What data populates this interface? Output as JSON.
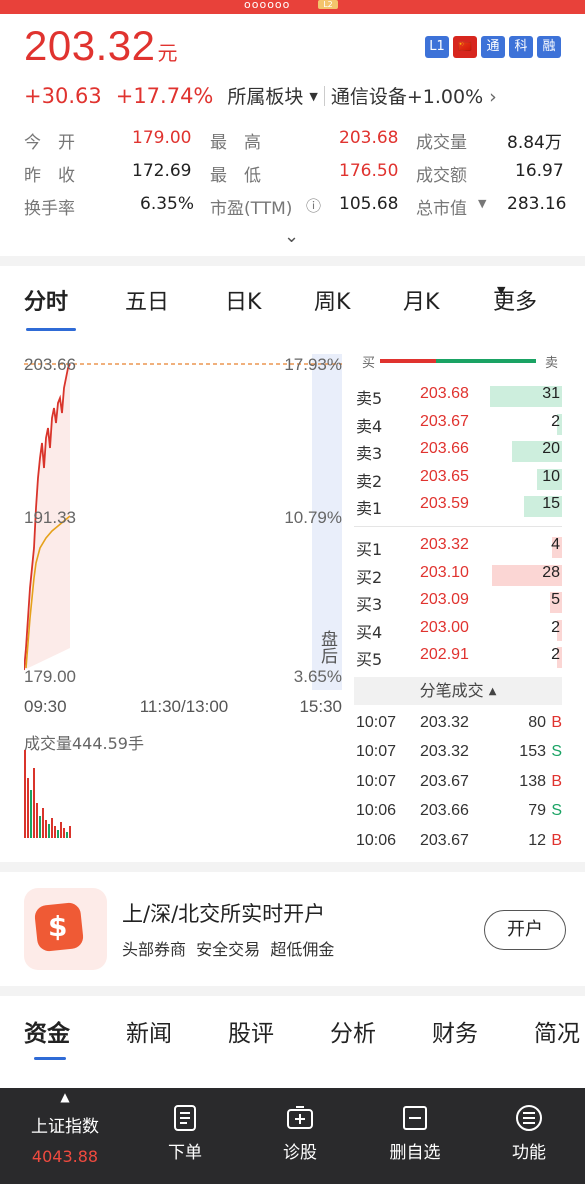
{
  "status": {
    "dots": "oooooo",
    "badge": "L2"
  },
  "header": {
    "price": "203.32",
    "price_unit": "元",
    "tags": [
      "L1",
      "🇨🇳",
      "通",
      "科",
      "融"
    ],
    "change": "+30.63",
    "change_pct": "+17.74%",
    "sector_label": "所属板块",
    "sector_name": "通信设备+1.00%"
  },
  "quotes": [
    [
      {
        "label": "今　开",
        "value": "179.00",
        "color": "red"
      },
      {
        "label": "最　高",
        "value": "203.68",
        "color": "red"
      },
      {
        "label": "成交量",
        "value": "8.84万",
        "color": "dark"
      }
    ],
    [
      {
        "label": "昨　收",
        "value": "172.69",
        "color": "dark"
      },
      {
        "label": "最　低",
        "value": "176.50",
        "color": "red"
      },
      {
        "label": "成交额",
        "value": "16.97",
        "color": "dark"
      }
    ],
    [
      {
        "label": "换手率",
        "value": "6.35%",
        "color": "dark"
      },
      {
        "label": "市盈(TTM)",
        "value": "105.68",
        "color": "dark"
      },
      {
        "label": "总市值",
        "value": "283.16",
        "color": "dark"
      }
    ]
  ],
  "tabs": [
    "分时",
    "五日",
    "日K",
    "周K",
    "月K",
    "更多"
  ],
  "chart": {
    "y_high": "203.66",
    "y_mid": "191.33",
    "y_low": "179.00",
    "pct_high": "17.93%",
    "pct_mid": "10.79%",
    "pct_low": "3.65%",
    "after_hours": "盘后",
    "t_start": "09:30",
    "t_mid": "11:30/13:00",
    "t_end": "15:30",
    "volume_label": "成交量444.59手"
  },
  "orderbook": {
    "buy_label": "买",
    "sell_label": "卖",
    "asks": [
      {
        "label": "卖5",
        "price": "203.68",
        "vol": "31",
        "bar": 0.9
      },
      {
        "label": "卖4",
        "price": "203.67",
        "vol": "2",
        "bar": 0.06
      },
      {
        "label": "卖3",
        "price": "203.66",
        "vol": "20",
        "bar": 0.62
      },
      {
        "label": "卖2",
        "price": "203.65",
        "vol": "10",
        "bar": 0.31
      },
      {
        "label": "卖1",
        "price": "203.59",
        "vol": "15",
        "bar": 0.47
      }
    ],
    "bids": [
      {
        "label": "买1",
        "price": "203.32",
        "vol": "4",
        "bar": 0.12
      },
      {
        "label": "买2",
        "price": "203.10",
        "vol": "28",
        "bar": 0.87
      },
      {
        "label": "买3",
        "price": "203.09",
        "vol": "5",
        "bar": 0.15
      },
      {
        "label": "买4",
        "price": "203.00",
        "vol": "2",
        "bar": 0.06
      },
      {
        "label": "买5",
        "price": "202.91",
        "vol": "2",
        "bar": 0.06
      }
    ],
    "trades_label": "分笔成交",
    "trades": [
      {
        "time": "10:07",
        "price": "203.32",
        "vol": "80",
        "side": "B"
      },
      {
        "time": "10:07",
        "price": "203.32",
        "vol": "153",
        "side": "S"
      },
      {
        "time": "10:07",
        "price": "203.67",
        "vol": "138",
        "side": "B"
      },
      {
        "time": "10:06",
        "price": "203.66",
        "vol": "79",
        "side": "S"
      },
      {
        "time": "10:06",
        "price": "203.67",
        "vol": "12",
        "side": "B"
      }
    ]
  },
  "promo": {
    "title": "上/深/北交所实时开户",
    "subtitle": "头部券商  安全交易  超低佣金",
    "button": "开户"
  },
  "tabs2": [
    "资金",
    "新闻",
    "股评",
    "分析",
    "财务",
    "简况"
  ],
  "bottom_nav": {
    "index_name": "上证指数",
    "index_value": "4043.88",
    "items": [
      "下单",
      "诊股",
      "删自选",
      "功能"
    ]
  },
  "colors": {
    "up": "#e0332f",
    "down": "#1aa364",
    "accent": "#2f6bd6",
    "avg_line": "#e5a11b"
  }
}
